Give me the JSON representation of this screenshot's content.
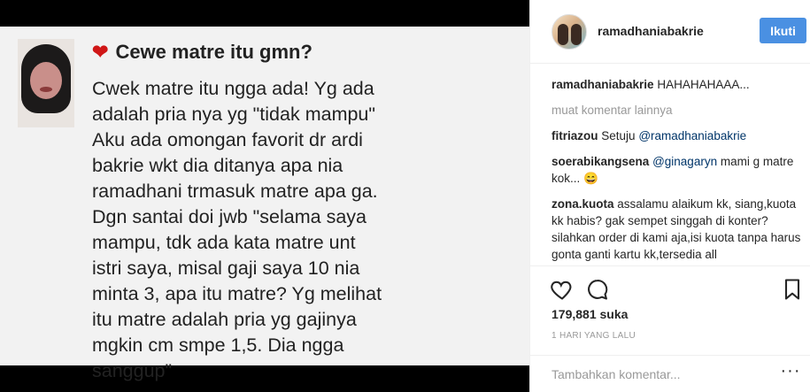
{
  "post": {
    "question_title": "Cewe matre itu gmn?",
    "question_body": "Cwek matre itu ngga ada! Yg ada\nadalah pria nya yg \"tidak mampu\"\nAku ada omongan favorit dr ardi\nbakrie wkt dia ditanya apa nia\nramadhani trmasuk matre apa ga.\nDgn santai doi jwb \"selama saya\nmampu, tdk ada kata matre unt\nistri saya, misal gaji saya 10 nia\nminta 3, apa itu matre? Yg melihat\nitu matre adalah pria yg gajinya\nmgkin cm smpe 1,5. Dia ngga\nsanggup\""
  },
  "header": {
    "username": "ramadhaniabakrie",
    "follow_label": "Ikuti"
  },
  "comments": {
    "caption": {
      "user": "ramadhaniabakrie",
      "text": "HAHAHAHAAA..."
    },
    "load_more": "muat komentar lainnya",
    "items": [
      {
        "user": "fitriazou",
        "text": "Setuju",
        "mention": "@ramadhaniabakrie",
        "rest": ""
      },
      {
        "user": "soerabikangsena",
        "text": "",
        "mention": "@ginagaryn",
        "rest": " mami g matre kok... 😄"
      },
      {
        "user": "zona.kuota",
        "text": "assalamu alaikum kk, siang,kuota kk habis? gak sempet singgah di konter?silahkan order di kami aja,isi kuota tanpa harus gonta ganti kartu kk,tersedia all operator,transaksi aman dan trust,fast response.jangan lupa follow kami ya kak",
        "mention": "",
        "rest": ""
      }
    ]
  },
  "actions": {
    "likes": "179,881 suka",
    "timestamp": "1 HARI YANG LALU"
  },
  "add_comment": {
    "placeholder": "Tambahkan komentar..."
  },
  "colors": {
    "accent": "#4a90e2",
    "mention": "#003569",
    "heart": "#d01717"
  }
}
